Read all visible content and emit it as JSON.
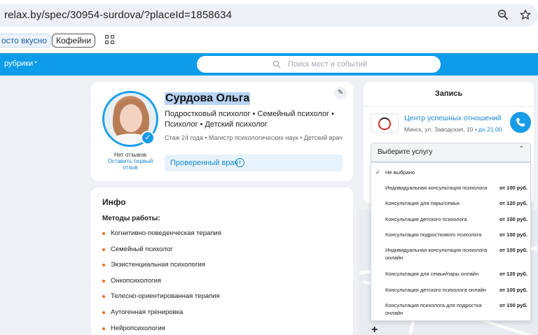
{
  "browser": {
    "url": "relax.by/spec/30954-surdova/?placeId=1858634",
    "zoom_icon": "zoom-out-icon",
    "star_icon": "star-icon"
  },
  "bookmarks": {
    "chip1": "осто вкусно",
    "chip2": "Кофейни"
  },
  "header": {
    "rubrics": "рубрики",
    "search_placeholder": "Поиск мест и событий"
  },
  "profile": {
    "name": "Сурдова Ольга",
    "specialties": "Подростковый психолог • Семейный психолог • Психолог • Детский психолог",
    "experience": "Стаж 24 года • Магистр психологических наук • Детский врач",
    "verified": "Проверенный врач",
    "no_reviews": "Нет отзывов",
    "leave_review": "Оставить первый отзыв"
  },
  "info": {
    "title": "Инфо",
    "methods_title": "Методы работы:",
    "methods": [
      "Когнитивно-поведенческая терапия",
      "Семейный психолог",
      "Экзистенциальная психология",
      "Онкопсихология",
      "Телесно-ориентированная терапия",
      "Аутогенная тренировка",
      "Нейропсихология"
    ]
  },
  "booking": {
    "title": "Запись",
    "center_name": "Центр успешных отношений",
    "center_address": "Минск, ул. Заводская, 10",
    "center_hours": "до 21:00",
    "select_label": "Выберите услугу",
    "options": [
      {
        "label": "Не выбрано",
        "price": "",
        "selected": true
      },
      {
        "label": "Индивидуальная консультация психолога",
        "price": "от 100 руб."
      },
      {
        "label": "Консультация для пары/семьи",
        "price": "от 120 руб."
      },
      {
        "label": "Консультация детского психолога",
        "price": "от 100 руб."
      },
      {
        "label": "Консультация подросткового психолога",
        "price": "от 100 руб."
      },
      {
        "label": "Индивидуальная консультация психолога онлайн",
        "price": "от 100 руб."
      },
      {
        "label": "Консультация для семьи/пары онлайн",
        "price": "от 120 руб."
      },
      {
        "label": "Консультация детского психолога онлайн",
        "price": "от 100 руб."
      },
      {
        "label": "Консультация психолога для подростка онлайн",
        "price": "от 100 руб."
      }
    ]
  },
  "colors": {
    "brand_blue": "#0d9ce9",
    "link_blue": "#1a86d0",
    "bullet_orange": "#f26b21"
  }
}
